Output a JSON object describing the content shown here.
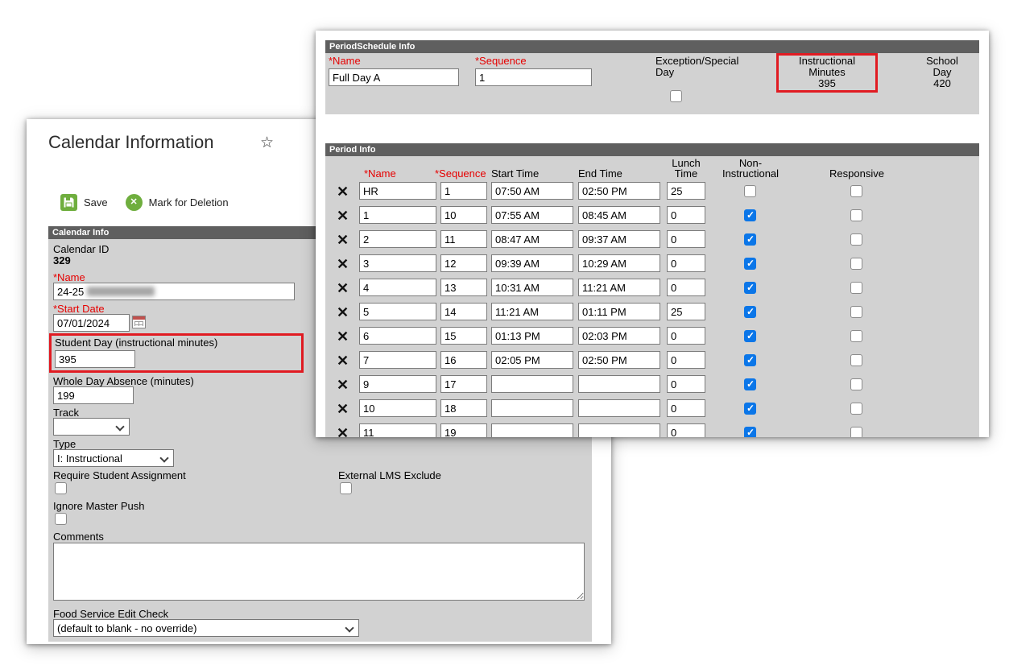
{
  "colors": {
    "highlight_red": "#e11b22",
    "label_red": "#e60000",
    "checkbox_blue": "#0b76e8",
    "section_bar": "#5f5f5f",
    "form_gray": "#d2d2d2",
    "icon_green": "#6fae3e"
  },
  "icons": {
    "star": "☆",
    "delete_row": "✕",
    "toolbar_x": "✕"
  },
  "calendar_panel": {
    "title": "Calendar Information",
    "toolbar": {
      "save": "Save",
      "mark_for_deletion": "Mark for Deletion"
    },
    "section": "Calendar Info",
    "calendar_id": {
      "label": "Calendar ID",
      "value": "329"
    },
    "name": {
      "label": "*Name",
      "value": "24-25"
    },
    "start_date": {
      "label": "*Start Date",
      "value": "07/01/2024"
    },
    "student_day": {
      "label": "Student Day (instructional minutes)",
      "value": "395"
    },
    "whole_day_absence": {
      "label": "Whole Day Absence (minutes)",
      "value": "199"
    },
    "track": {
      "label": "Track",
      "value": ""
    },
    "type": {
      "label": "Type",
      "value": "I: Instructional"
    },
    "require_student_assignment": {
      "label": "Require Student Assignment",
      "checked": false
    },
    "external_lms_exclude": {
      "label": "External LMS Exclude",
      "checked": false
    },
    "ignore_master_push": {
      "label": "Ignore Master Push",
      "checked": false
    },
    "comments": {
      "label": "Comments",
      "value": ""
    },
    "food_service_edit_check": {
      "label": "Food Service Edit Check",
      "value": "(default to blank - no override)"
    }
  },
  "period_schedule": {
    "section": "PeriodSchedule Info",
    "name": {
      "label": "*Name",
      "value": "Full Day A"
    },
    "sequence": {
      "label": "*Sequence",
      "value": "1"
    },
    "exception": {
      "line1": "Exception/Special",
      "line2": "Day",
      "checked": false
    },
    "instructional_minutes": {
      "line1": "Instructional",
      "line2": "Minutes",
      "value": "395"
    },
    "school_day": {
      "line1": "School",
      "line2": "Day",
      "value": "420"
    }
  },
  "period_info": {
    "section": "Period Info",
    "headers": {
      "name": "*Name",
      "sequence": "*Sequence",
      "start": "Start Time",
      "end": "End Time",
      "lunch_line1": "Lunch",
      "lunch_line2": "Time",
      "noninstr_line1": "Non-",
      "noninstr_line2": "Instructional",
      "responsive": "Responsive"
    },
    "rows": [
      {
        "name": "HR",
        "sequence": "1",
        "start": "07:50 AM",
        "end": "02:50 PM",
        "lunch": "25",
        "non_instructional": false,
        "responsive": false
      },
      {
        "name": "1",
        "sequence": "10",
        "start": "07:55 AM",
        "end": "08:45 AM",
        "lunch": "0",
        "non_instructional": true,
        "responsive": false
      },
      {
        "name": "2",
        "sequence": "11",
        "start": "08:47 AM",
        "end": "09:37 AM",
        "lunch": "0",
        "non_instructional": true,
        "responsive": false
      },
      {
        "name": "3",
        "sequence": "12",
        "start": "09:39 AM",
        "end": "10:29 AM",
        "lunch": "0",
        "non_instructional": true,
        "responsive": false
      },
      {
        "name": "4",
        "sequence": "13",
        "start": "10:31 AM",
        "end": "11:21 AM",
        "lunch": "0",
        "non_instructional": true,
        "responsive": false
      },
      {
        "name": "5",
        "sequence": "14",
        "start": "11:21 AM",
        "end": "01:11 PM",
        "lunch": "25",
        "non_instructional": true,
        "responsive": false
      },
      {
        "name": "6",
        "sequence": "15",
        "start": "01:13 PM",
        "end": "02:03 PM",
        "lunch": "0",
        "non_instructional": true,
        "responsive": false
      },
      {
        "name": "7",
        "sequence": "16",
        "start": "02:05 PM",
        "end": "02:50 PM",
        "lunch": "0",
        "non_instructional": true,
        "responsive": false
      },
      {
        "name": "9",
        "sequence": "17",
        "start": "",
        "end": "",
        "lunch": "0",
        "non_instructional": true,
        "responsive": false
      },
      {
        "name": "10",
        "sequence": "18",
        "start": "",
        "end": "",
        "lunch": "0",
        "non_instructional": true,
        "responsive": false
      },
      {
        "name": "11",
        "sequence": "19",
        "start": "",
        "end": "",
        "lunch": "0",
        "non_instructional": true,
        "responsive": false
      }
    ]
  }
}
